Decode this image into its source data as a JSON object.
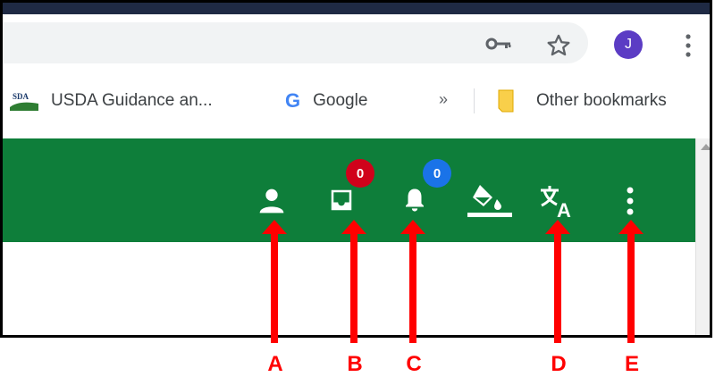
{
  "toolbar": {
    "avatar_initial": "J"
  },
  "bookmarks": {
    "items": [
      {
        "label": "USDA Guidance an...",
        "icon": "usda-icon"
      },
      {
        "label": "Google",
        "icon": "google-icon"
      }
    ],
    "overflow_label": "»",
    "other_label": "Other bookmarks"
  },
  "app_bar": {
    "color": "#0e7e3a",
    "inbox_badge": "0",
    "inbox_badge_color": "#d0021b",
    "notifications_badge": "0",
    "notifications_badge_color": "#1a73e8"
  },
  "annotations": {
    "labels": [
      "A",
      "B",
      "C",
      "D",
      "E"
    ],
    "color": "#ff0000"
  }
}
